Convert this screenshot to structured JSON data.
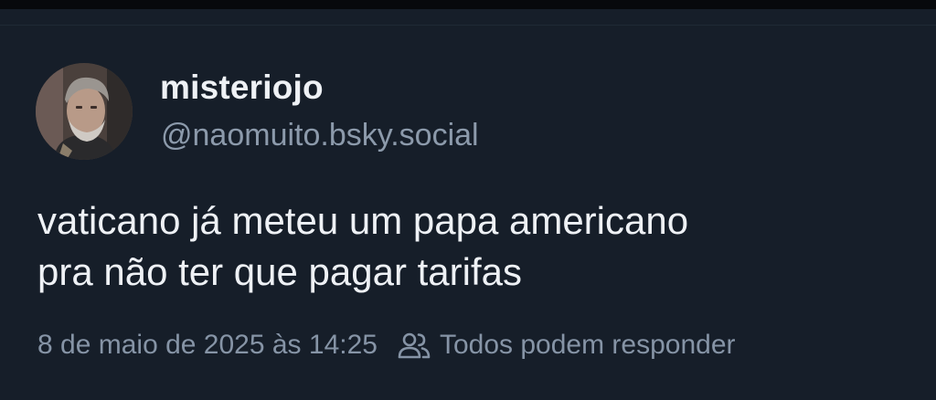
{
  "post": {
    "author": {
      "display_name": "misteriojo",
      "handle": "@naomuito.bsky.social"
    },
    "text_lines": [
      "vaticano já meteu um papa americano",
      "pra não ter que pagar tarifas"
    ],
    "timestamp": "8 de maio de 2025 às 14:25",
    "reply_permission": "Todos podem responder",
    "reply_permission_icon": "users-icon"
  },
  "colors": {
    "background": "#161e29",
    "text_primary": "#eef1f5",
    "text_secondary": "#8c9aab"
  }
}
